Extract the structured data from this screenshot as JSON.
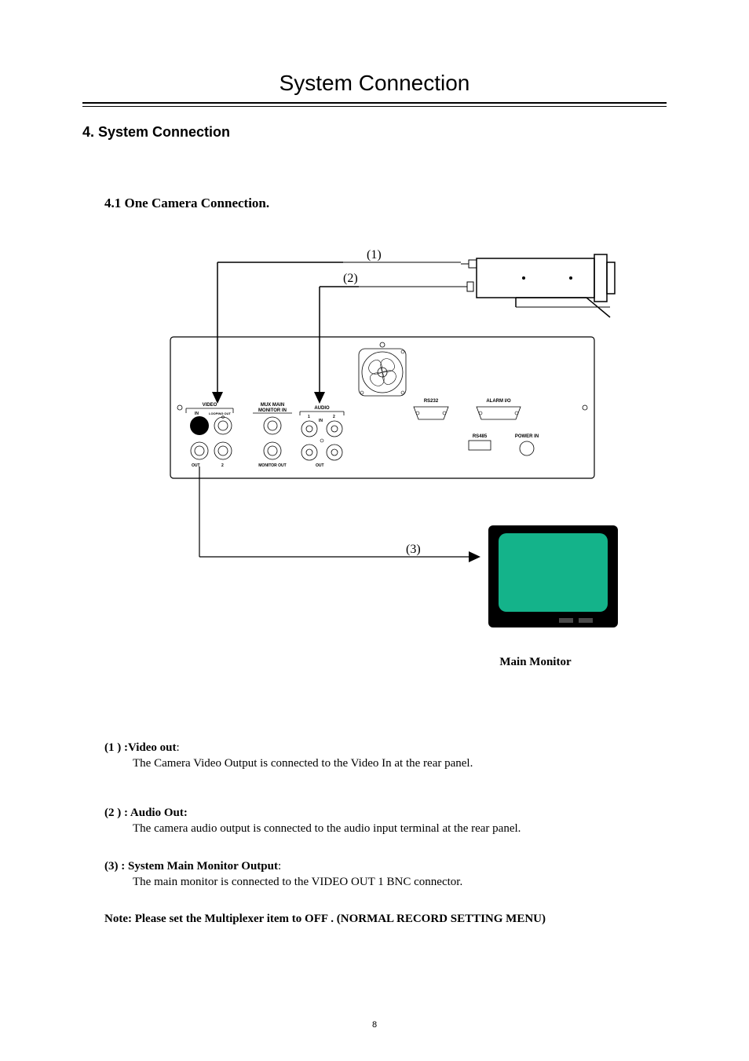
{
  "page_title": "System Connection",
  "section_heading": "4. System Connection",
  "subsection_heading": "4.1  One Camera  Connection.",
  "diagram": {
    "callouts": {
      "c1": "(1)",
      "c2": "(2)",
      "c3": "(3)"
    },
    "panel_labels": {
      "video": "VIDEO",
      "in": "IN",
      "looping_out": "LOOPING OUT",
      "out": "OUT",
      "mux_main": "MUX MAIN",
      "monitor_in": "MONITOR IN",
      "monitor_out": "MONITOR OUT",
      "audio": "AUDIO",
      "a1": "1",
      "a2": "2",
      "a_in": "IN",
      "a_out": "OUT",
      "rs232": "RS232",
      "alarm_io": "ALARM I/O",
      "rs485": "RS485",
      "power_in": "POWER IN"
    },
    "monitor_caption": "Main Monitor"
  },
  "definitions": [
    {
      "label": "(1 ) :Video  out",
      "suffix": ":",
      "body": "The Camera Video Output is connected to the Video In at the rear panel."
    },
    {
      "label": "(2 ) : Audio Out:",
      "suffix": "",
      "body": "The camera audio output is connected to the audio input terminal at the rear panel."
    },
    {
      "label": "(3) : System Main Monitor Output",
      "suffix": ":",
      "body": "The main monitor is connected to the VIDEO OUT 1 BNC connector."
    }
  ],
  "note": "Note: Please set the Multiplexer item to OFF . (NORMAL RECORD SETTING MENU)",
  "page_number": "8"
}
